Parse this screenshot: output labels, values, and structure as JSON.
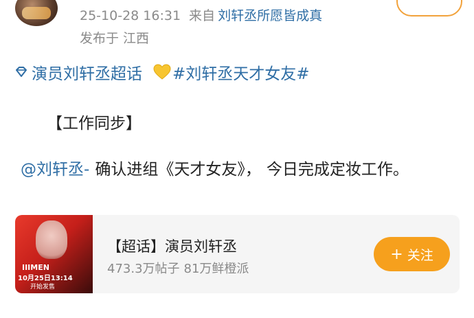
{
  "post": {
    "timestamp": "25-10-28 16:31",
    "source_prefix": "来自",
    "source_name": "刘轩丞所愿皆成真",
    "location": "发布于 江西"
  },
  "topics": {
    "super_topic": "演员刘轩丞超话",
    "hashtag": "#刘轩丞天才女友#"
  },
  "body": {
    "heading": "【工作同步】",
    "mention": "@刘轩丞-",
    "text_part1": "确认进组《天才女友》，",
    "text_part2": "今日完成定妆工作。"
  },
  "card": {
    "title": "【超话】演员刘轩丞",
    "posts_count": "473.3万帖子",
    "fans_count": "81万鲜橙派",
    "follow_plus": "+",
    "follow_label": "关注",
    "thumb_brand": "IIIMEN",
    "thumb_date": "10月25日13:14",
    "thumb_sale": "开始发售"
  },
  "icons": {
    "super_topic_icon": "diamond-icon",
    "heart_icon": "yellow-heart-icon"
  },
  "colors": {
    "link": "#2f6ea5",
    "accent": "#f6a01d",
    "muted": "#8a8a8a"
  }
}
